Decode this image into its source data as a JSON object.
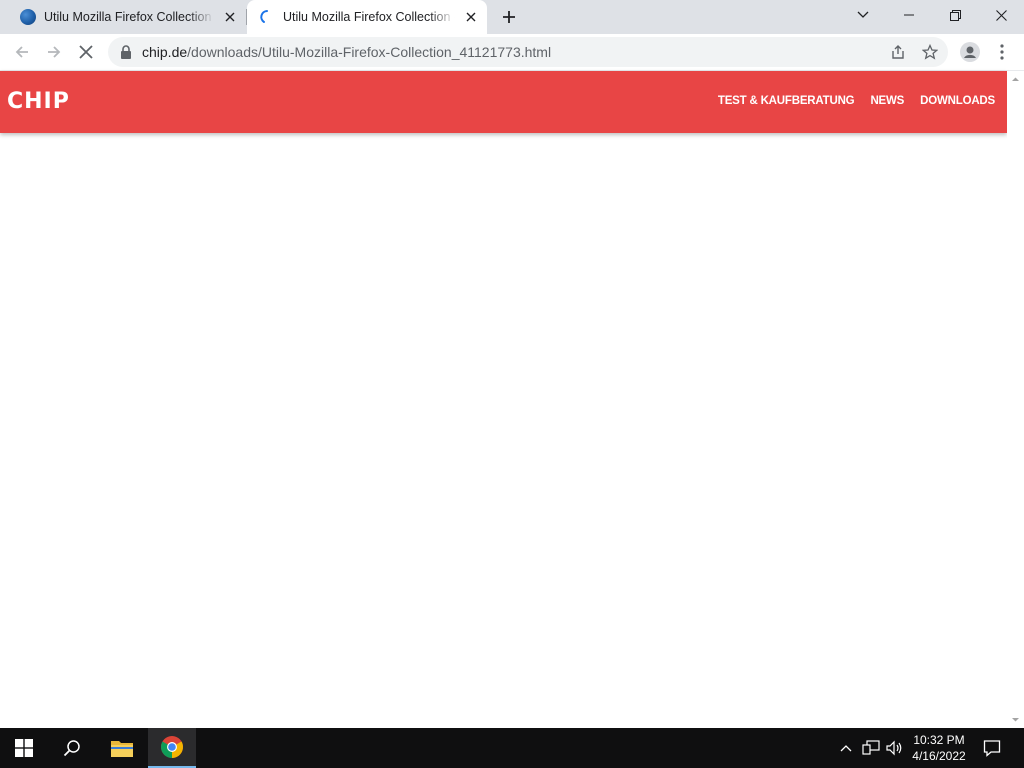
{
  "browser": {
    "tabs": [
      {
        "title": "Utilu Mozilla Firefox Collection -",
        "state": "loaded",
        "favicon": "globe-icon"
      },
      {
        "title": "Utilu Mozilla Firefox Collection -",
        "state": "loading",
        "favicon": "loading-spinner-icon",
        "active": true
      }
    ],
    "url_host": "chip.de",
    "url_path": "/downloads/Utilu-Mozilla-Firefox-Collection_41121773.html"
  },
  "site": {
    "logo": "CHIP",
    "brand_color": "#e84545",
    "nav": [
      "TEST & KAUFBERATUNG",
      "NEWS",
      "DOWNLOADS"
    ]
  },
  "taskbar": {
    "time": "10:32 PM",
    "date": "4/16/2022"
  }
}
